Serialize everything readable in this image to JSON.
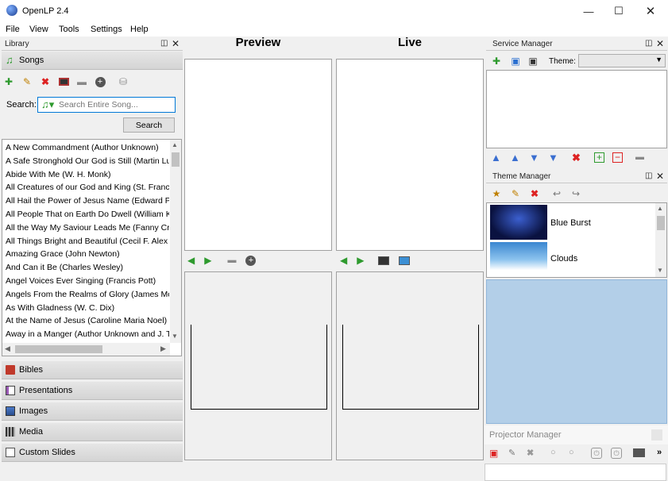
{
  "app": {
    "title": "OpenLP 2.4"
  },
  "menu": [
    "File",
    "View",
    "Tools",
    "Settings",
    "Help"
  ],
  "library": {
    "dock_title": "Library",
    "active_section": "Songs",
    "search_label": "Search:",
    "search_placeholder": "Search Entire Song...",
    "search_button": "Search",
    "songs": [
      "A New Commandment (Author Unknown)",
      "A Safe Stronghold Our God is Still (Martin Lu",
      "Abide With Me (W. H. Monk)",
      "All Creatures of our God and King (St. Franci",
      "All Hail the Power of Jesus Name (Edward Pe",
      "All People That on Earth Do Dwell (William K",
      "All the Way My Saviour Leads Me (Fanny Cro",
      "All Things Bright and Beautiful (Cecil F. Alex",
      "Amazing Grace (John Newton)",
      "And Can it Be (Charles Wesley)",
      "Angel Voices Ever Singing (Francis Pott)",
      "Angels From the Realms of Glory (James Mo",
      "As With Gladness (W. C. Dix)",
      "At the Name of Jesus (Caroline Maria Noel)",
      "Away in a Manger (Author Unknown and J. T"
    ],
    "sections": [
      "Bibles",
      "Presentations",
      "Images",
      "Media",
      "Custom Slides"
    ]
  },
  "preview": {
    "title": "Preview"
  },
  "live": {
    "title": "Live"
  },
  "service_manager": {
    "dock_title": "Service Manager",
    "theme_label": "Theme:",
    "theme_value": ""
  },
  "theme_manager": {
    "dock_title": "Theme Manager",
    "themes": [
      "Blue Burst",
      "Clouds"
    ]
  },
  "projector_manager": {
    "dock_title": "Projector Manager"
  },
  "colors": {
    "accent": "#b3cfe8",
    "selection": "#0078d7"
  }
}
